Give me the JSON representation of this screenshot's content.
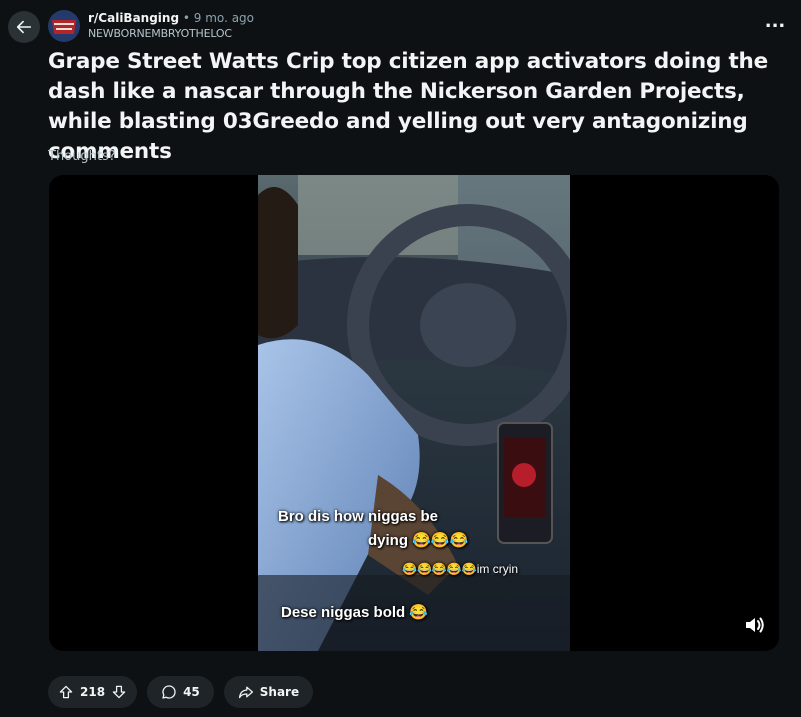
{
  "post": {
    "subreddit": "r/CaliBanging",
    "separator": "•",
    "age": "9 mo. ago",
    "author": "NEWBORNEMBRYOTHELOC",
    "more_label": "...",
    "title": "Grape Street Watts Crip top citizen app activators doing the dash like a nascar through the Nickerson Garden Projects, while blasting 03Greedo and yelling out very antagonizing comments",
    "body": "Thoughts?"
  },
  "video": {
    "caption_1": "Bro dis how niggas be",
    "caption_2": "dying 😂😂😂",
    "caption_3": "😂😂😂😂😂im cryin",
    "caption_4": "Dese niggas bold 😂",
    "volume_icon": "volume-icon"
  },
  "actions": {
    "upvote_icon": "upvote-icon",
    "score": "218",
    "downvote_icon": "downvote-icon",
    "comment_icon": "comment-icon",
    "comments": "45",
    "share_icon": "share-icon",
    "share_label": "Share"
  },
  "colors": {
    "background": "#0e1113",
    "pill_background": "#1e2428",
    "text_primary": "#f2f4f5",
    "text_secondary": "#b7c5cc"
  }
}
